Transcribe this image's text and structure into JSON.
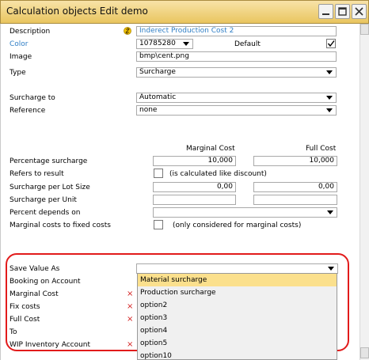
{
  "window": {
    "title": "Calculation objects Edit demo"
  },
  "fields": {
    "description": {
      "label": "Description",
      "value": "Inderect Production Cost 2"
    },
    "color": {
      "label": "Color",
      "value": "10785280",
      "default_label": "Default"
    },
    "image": {
      "label": "Image",
      "value": "bmp\\cent.png"
    },
    "type": {
      "label": "Type",
      "value": "Surcharge"
    },
    "surcharge_to": {
      "label": "Surcharge to",
      "value": "Automatic"
    },
    "reference": {
      "label": "Reference",
      "value": "none"
    }
  },
  "cost_table": {
    "marginal_header": "Marginal Cost",
    "full_header": "Full Cost",
    "percentage_surcharge": {
      "label": "Percentage surcharge",
      "marginal": "10,000",
      "full": "10,000"
    },
    "refers_to_result": {
      "label": "Refers to result",
      "note": "(is calculated like discount)"
    },
    "surcharge_per_lot": {
      "label": "Surcharge per Lot Size",
      "marginal": "0,00",
      "full": "0,00"
    },
    "surcharge_per_unit": {
      "label": "Surcharge per Unit"
    },
    "percent_depends_on": {
      "label": "Percent depends on"
    },
    "marginal_to_fixed": {
      "label": "Marginal costs to fixed costs",
      "note": "(only considered for marginal costs)"
    }
  },
  "lower": {
    "save_value_as": "Save Value As",
    "booking_on_account": "Booking on Account",
    "marginal_cost": "Marginal Cost",
    "fix_costs": "Fix costs",
    "full_cost": "Full Cost",
    "to": "To",
    "wip_inventory_account": "WIP Inventory Account",
    "x_mark": "×"
  },
  "dropdown_options": [
    "Material surcharge",
    "Production surcharge",
    "option2",
    "option3",
    "option4",
    "option5",
    "option10"
  ],
  "selected_option_index": 0
}
